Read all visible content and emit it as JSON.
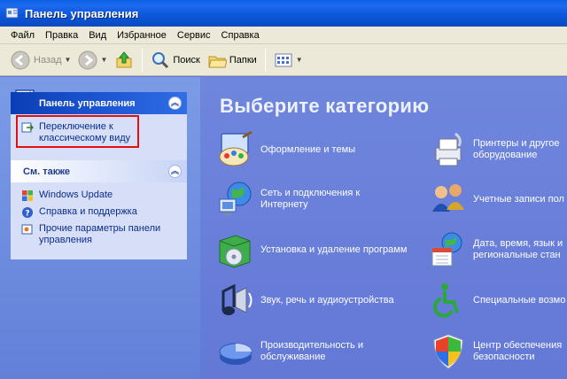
{
  "window": {
    "title": "Панель управления"
  },
  "menu": [
    "Файл",
    "Правка",
    "Вид",
    "Избранное",
    "Сервис",
    "Справка"
  ],
  "toolbar": {
    "back_label": "Назад",
    "search_label": "Поиск",
    "folders_label": "Папки"
  },
  "left_panel": {
    "control_panel": {
      "title": "Панель управления",
      "switch_link": "Переключение к классическому виду"
    },
    "see_also": {
      "title": "См. также",
      "links": [
        "Windows Update",
        "Справка и поддержка",
        "Прочие параметры панели управления"
      ]
    }
  },
  "main": {
    "heading": "Выберите категорию",
    "categories_left": [
      {
        "label": "Оформление и темы",
        "icon": "appearance-icon"
      },
      {
        "label": "Сеть и подключения к Интернету",
        "icon": "network-icon"
      },
      {
        "label": "Установка и удаление программ",
        "icon": "add-remove-icon"
      },
      {
        "label": "Звук, речь и аудиоустройства",
        "icon": "sound-icon"
      },
      {
        "label": "Производительность и обслуживание",
        "icon": "performance-icon"
      }
    ],
    "categories_right": [
      {
        "label": "Принтеры и другое оборудование",
        "icon": "printer-icon"
      },
      {
        "label": "Учетные записи пол",
        "icon": "users-icon"
      },
      {
        "label": "Дата, время, язык и региональные стан",
        "icon": "date-time-icon"
      },
      {
        "label": "Специальные возмо",
        "icon": "accessibility-icon"
      },
      {
        "label": "Центр обеспечения безопасности",
        "icon": "security-center-icon"
      }
    ]
  }
}
